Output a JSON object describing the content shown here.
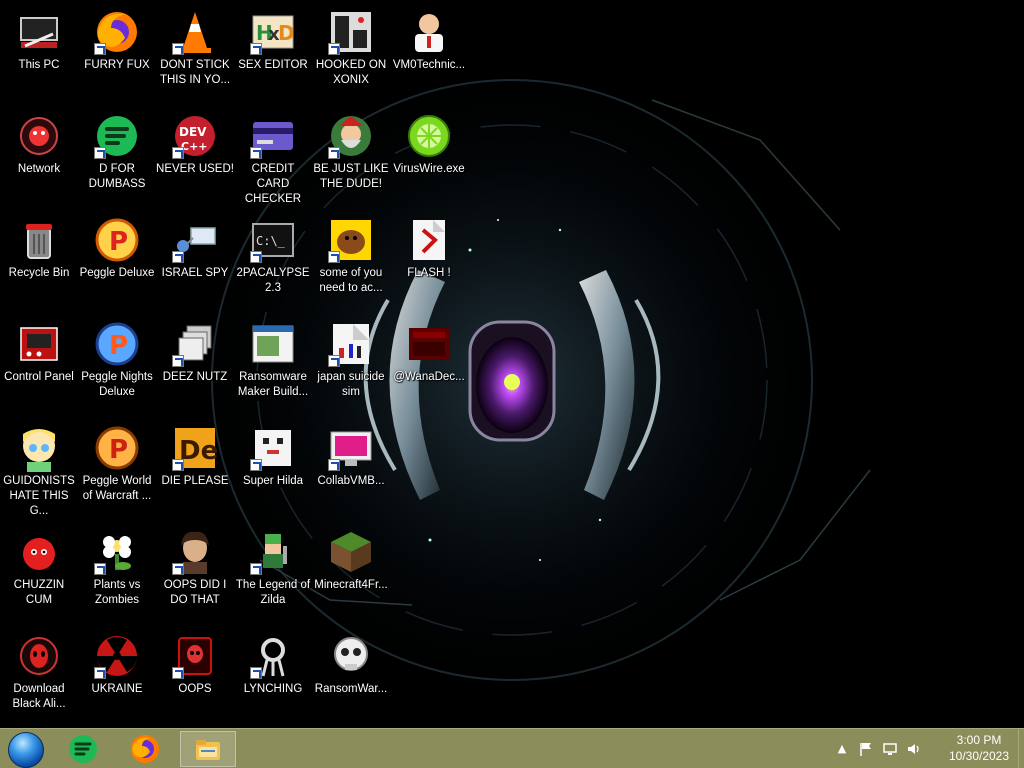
{
  "desktop": {
    "icons": [
      {
        "label": "This PC",
        "icon": "computer-icon",
        "shortcut": false
      },
      {
        "label": "Network",
        "icon": "network-alien-icon",
        "shortcut": false
      },
      {
        "label": "Recycle Bin",
        "icon": "recycle-bin-icon",
        "shortcut": false
      },
      {
        "label": "Control Panel",
        "icon": "control-panel-icon",
        "shortcut": false
      },
      {
        "label": "GUIDONISTS HATE THIS G...",
        "icon": "cartoon-girl-icon",
        "shortcut": false
      },
      {
        "label": "CHUZZIN CUM",
        "icon": "red-fuzzball-icon",
        "shortcut": false
      },
      {
        "label": "Download Black Ali...",
        "icon": "alien-head-icon",
        "shortcut": false
      },
      {
        "label": "FURRY FUX",
        "icon": "firefox-icon",
        "shortcut": true
      },
      {
        "label": "D FOR DUMBASS",
        "icon": "spotify-like-green-icon",
        "shortcut": true
      },
      {
        "label": "Peggle Deluxe",
        "icon": "peggle-icon",
        "shortcut": false
      },
      {
        "label": "Peggle Nights Deluxe",
        "icon": "peggle-nights-icon",
        "shortcut": false
      },
      {
        "label": "Peggle World of Warcraft ...",
        "icon": "peggle-wow-icon",
        "shortcut": false
      },
      {
        "label": "Plants vs Zombies",
        "icon": "flower-icon",
        "shortcut": true
      },
      {
        "label": "UKRAINE",
        "icon": "radiation-icon",
        "shortcut": true
      },
      {
        "label": "DONT STICK THIS IN YO...",
        "icon": "traffic-cone-icon",
        "shortcut": true
      },
      {
        "label": "NEVER USED!",
        "icon": "devcpp-icon",
        "shortcut": true
      },
      {
        "label": "ISRAEL SPY",
        "icon": "network-spy-icon",
        "shortcut": true
      },
      {
        "label": "DEEZ NUTZ",
        "icon": "stacked-windows-icon",
        "shortcut": true
      },
      {
        "label": "DIE PLEASE",
        "icon": "de-icon",
        "shortcut": true
      },
      {
        "label": "OOPS DID I DO THAT",
        "icon": "portrait-icon",
        "shortcut": true
      },
      {
        "label": "OOPS",
        "icon": "red-skull-icon",
        "shortcut": true
      },
      {
        "label": "SEX EDITOR",
        "icon": "hxd-icon",
        "shortcut": true
      },
      {
        "label": "CREDIT CARD CHECKER",
        "icon": "credit-card-icon",
        "shortcut": true
      },
      {
        "label": "2PACALYPSE 2.3",
        "icon": "terminal-icon",
        "shortcut": true
      },
      {
        "label": "Ransomware Maker Build...",
        "icon": "window-app-icon",
        "shortcut": false
      },
      {
        "label": "Super Hilda",
        "icon": "pixel-art-icon",
        "shortcut": true
      },
      {
        "label": "The Legend of Zilda",
        "icon": "pixel-hero-icon",
        "shortcut": true
      },
      {
        "label": "LYNCHING",
        "icon": "rope-icon",
        "shortcut": true
      },
      {
        "label": "HOOKED ON XONIX",
        "icon": "xonix-icon",
        "shortcut": true
      },
      {
        "label": "BE JUST LIKE THE DUDE!",
        "icon": "dude-icon",
        "shortcut": true
      },
      {
        "label": "some of you need to ac...",
        "icon": "cartoon-dog-icon",
        "shortcut": true
      },
      {
        "label": "japan suicide sim",
        "icon": "game-shortcut-icon",
        "shortcut": true
      },
      {
        "label": "CollabVMB...",
        "icon": "monitor-icon",
        "shortcut": true
      },
      {
        "label": "Minecraft4Fr...",
        "icon": "grass-block-icon",
        "shortcut": false
      },
      {
        "label": "RansomWar...",
        "icon": "skull-icon",
        "shortcut": false
      },
      {
        "label": "VM0Technic...",
        "icon": "doctor-icon",
        "shortcut": false
      },
      {
        "label": "VirusWire.exe",
        "icon": "lime-icon",
        "shortcut": false
      },
      {
        "label": "FLASH !",
        "icon": "flash-icon",
        "shortcut": false
      },
      {
        "label": "@WanaDec...",
        "icon": "wanadecrypt-icon",
        "shortcut": false
      }
    ]
  },
  "taskbar": {
    "start": "start-orb-icon",
    "pinned": [
      {
        "name": "spotify-like-green-icon",
        "active": false
      },
      {
        "name": "firefox-icon",
        "active": false
      },
      {
        "name": "file-explorer-icon",
        "active": true
      }
    ],
    "tray": {
      "time": "3:00 PM",
      "date": "10/30/2023"
    }
  },
  "colors": {
    "taskbar_bg": "#8b8d5a",
    "desktop_bg": "#000000"
  }
}
